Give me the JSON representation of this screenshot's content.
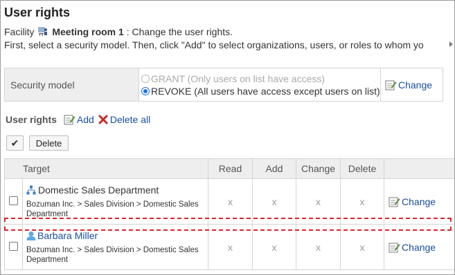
{
  "page": {
    "title": "User rights",
    "facility_label": "Facility",
    "facility_name": "Meeting room 1",
    "facility_suffix": ": Change the user rights.",
    "instructions": "First, select a security model. Then, click \"Add\" to select organizations, users, or roles to whom yo"
  },
  "security_model": {
    "label": "Security model",
    "option_grant": "GRANT (Only users on list have access)",
    "option_revoke": "REVOKE (All users have access except users on list)",
    "selected": "REVOKE",
    "change_label": "Change"
  },
  "user_rights": {
    "label": "User rights",
    "add_label": "Add",
    "delete_all_label": "Delete all",
    "checkall_label": "✔",
    "delete_label": "Delete",
    "columns": {
      "target": "Target",
      "read": "Read",
      "add": "Add",
      "change": "Change",
      "delete": "Delete"
    },
    "rows": [
      {
        "type": "organization",
        "name": "Domestic Sales Department",
        "path": "Bozuman Inc. > Sales Division > Domestic Sales Department",
        "read": "x",
        "add": "x",
        "change": "x",
        "delete": "x",
        "change_label": "Change"
      },
      {
        "type": "user",
        "name": "Barbara Miller",
        "path": "Bozuman Inc. > Sales Division > Domestic Sales Department",
        "read": "x",
        "add": "x",
        "change": "x",
        "delete": "x",
        "change_label": "Change"
      }
    ]
  },
  "colors": {
    "link": "#1a4ea0",
    "header_bg": "#eeeeee",
    "highlight": "#d9242b",
    "radio_selected": "#1a73e8"
  }
}
